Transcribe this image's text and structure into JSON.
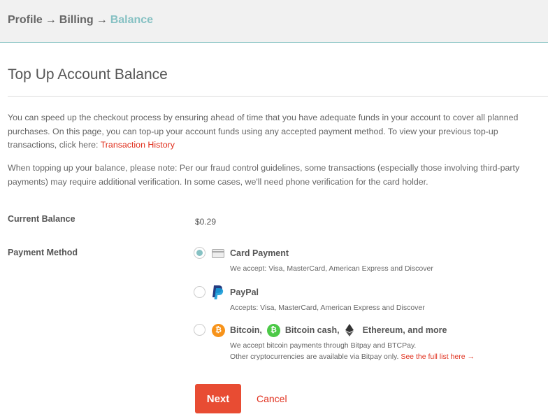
{
  "breadcrumb": {
    "items": [
      "Profile",
      "Billing",
      "Balance"
    ],
    "separator": "→"
  },
  "page": {
    "title": "Top Up Account Balance",
    "intro_text": "You can speed up the checkout process by ensuring ahead of time that you have adequate funds in your account to cover all planned purchases. On this page, you can top-up your account funds using any accepted payment method. To view your previous top-up transactions, click here: ",
    "history_link": "Transaction History",
    "note_text": "When topping up your balance, please note: Per our fraud control guidelines, some transactions (especially those involving third-party payments) may require additional verification. In some cases, we'll need phone verification for the card holder."
  },
  "form": {
    "balance_label": "Current Balance",
    "balance_value": "$0.29",
    "method_label": "Payment Method",
    "selected_method": "card",
    "options": [
      {
        "id": "card",
        "title": "Card Payment",
        "icon": "credit-card-icon",
        "desc": "We accept: Visa, MasterCard, American Express and Discover"
      },
      {
        "id": "paypal",
        "title": "PayPal",
        "icon": "paypal-icon",
        "desc": "Accepts: Visa, MasterCard, American Express and Discover"
      },
      {
        "id": "crypto",
        "title_parts": [
          "Bitcoin,",
          "Bitcoin cash,",
          "Ethereum, and more"
        ],
        "icons": [
          "bitcoin-icon",
          "bitcoin-cash-icon",
          "ethereum-icon"
        ],
        "desc_line1": "We accept bitcoin payments through Bitpay and BTCPay.",
        "desc_line2": "Other cryptocurrencies are available via Bitpay only. ",
        "list_link": "See the full list here →"
      }
    ]
  },
  "actions": {
    "next_label": "Next",
    "cancel_label": "Cancel"
  },
  "colors": {
    "accent_teal": "#86c1c3",
    "action_red": "#e84c33",
    "link_red": "#e0301e"
  }
}
